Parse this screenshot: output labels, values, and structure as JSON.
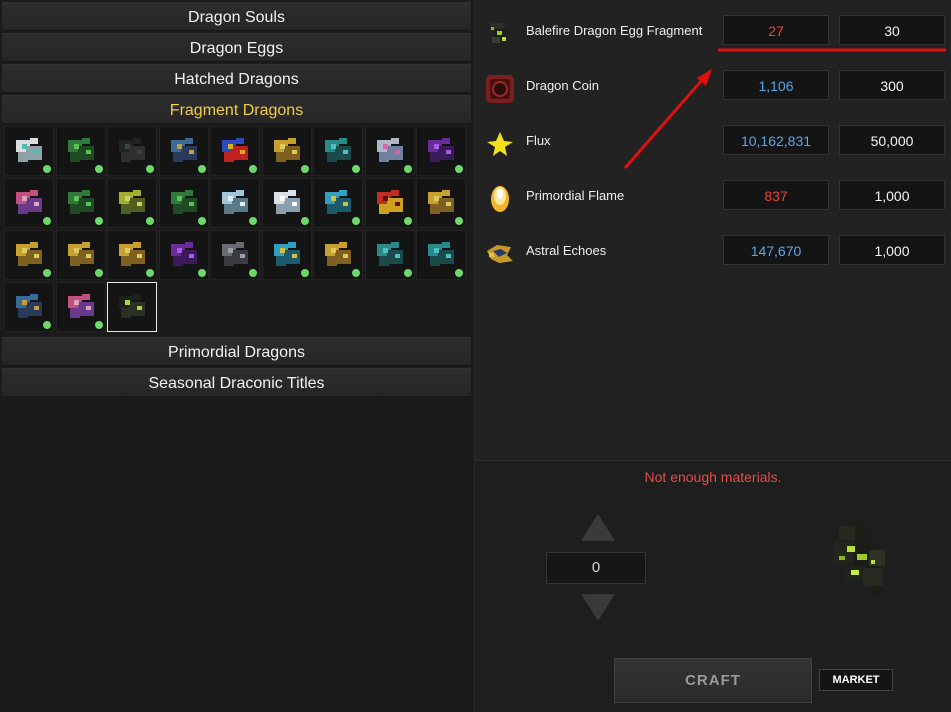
{
  "categories": [
    {
      "label": "Dragon Souls",
      "active": false
    },
    {
      "label": "Dragon Eggs",
      "active": false
    },
    {
      "label": "Hatched Dragons",
      "active": false
    },
    {
      "label": "Fragment Dragons",
      "active": true
    },
    {
      "label": "Primordial Dragons",
      "active": false
    },
    {
      "label": "Seasonal Draconic Titles",
      "active": false
    }
  ],
  "fragment_grid": {
    "items": [
      {
        "icon": "dragon-white-icon",
        "owned": true
      },
      {
        "icon": "dragon-green-icon",
        "owned": true
      },
      {
        "icon": "dragon-dark-icon",
        "owned": true
      },
      {
        "icon": "dragon-blue-icon",
        "owned": true
      },
      {
        "icon": "dragon-multicolor-icon",
        "owned": true
      },
      {
        "icon": "dragon-gold-icon",
        "owned": true
      },
      {
        "icon": "dragon-teal-icon",
        "owned": true
      },
      {
        "icon": "dragon-silver-icon",
        "owned": true
      },
      {
        "icon": "dragon-purple-icon",
        "owned": true
      },
      {
        "icon": "dragon-pink-icon",
        "owned": true
      },
      {
        "icon": "dragon-green-icon",
        "owned": true
      },
      {
        "icon": "dragon-yellowgreen-icon",
        "owned": true
      },
      {
        "icon": "dragon-green-icon",
        "owned": true
      },
      {
        "icon": "dragon-ice-icon",
        "owned": true
      },
      {
        "icon": "dragon-frost-icon",
        "owned": true
      },
      {
        "icon": "dragon-cyan-icon",
        "owned": true
      },
      {
        "icon": "dragon-fire-icon",
        "owned": true
      },
      {
        "icon": "dragon-gold-icon",
        "owned": true
      },
      {
        "icon": "dragon-gold-icon",
        "owned": true
      },
      {
        "icon": "dragon-gold-icon",
        "owned": true
      },
      {
        "icon": "dragon-gold-icon",
        "owned": true
      },
      {
        "icon": "dragon-purple-icon",
        "owned": true
      },
      {
        "icon": "dragon-steel-icon",
        "owned": true
      },
      {
        "icon": "dragon-cyan-icon",
        "owned": true
      },
      {
        "icon": "dragon-gold-icon",
        "owned": true
      },
      {
        "icon": "dragon-teal-icon",
        "owned": true
      },
      {
        "icon": "dragon-teal-icon",
        "owned": true
      },
      {
        "icon": "dragon-blue-icon",
        "owned": true
      },
      {
        "icon": "dragon-pink-icon",
        "owned": true
      },
      {
        "icon": "dragon-balefire-icon",
        "owned": false,
        "selected": true
      }
    ]
  },
  "materials": [
    {
      "icon": "balefire-fragment-icon",
      "name": "Balefire Dragon Egg Fragment",
      "have": "27",
      "need": "30",
      "have_color": "#e8453e"
    },
    {
      "icon": "dragon-coin-icon",
      "name": "Dragon Coin",
      "have": "1,106",
      "need": "300",
      "have_color": "#5ba4ea"
    },
    {
      "icon": "flux-icon",
      "name": "Flux",
      "have": "10,162,831",
      "need": "50,000",
      "have_color": "#5ba4ea"
    },
    {
      "icon": "primordial-flame-icon",
      "name": "Primordial Flame",
      "have": "837",
      "need": "1,000",
      "have_color": "#e8453e"
    },
    {
      "icon": "astral-echoes-icon",
      "name": "Astral Echoes",
      "have": "147,670",
      "need": "1,000",
      "have_color": "#5ba4ea"
    }
  ],
  "craft_panel": {
    "warning": "Not enough materials.",
    "quantity": "0",
    "craft_label": "CRAFT",
    "market_label": "MARKET",
    "preview_icon": "balefire-dragon-icon"
  },
  "colors": {
    "active_category": "#f4cd45",
    "insufficient": "#e8453e",
    "sufficient": "#5ba4ea",
    "annotation": "#e01010",
    "owned_dot": "#6ed86a"
  }
}
